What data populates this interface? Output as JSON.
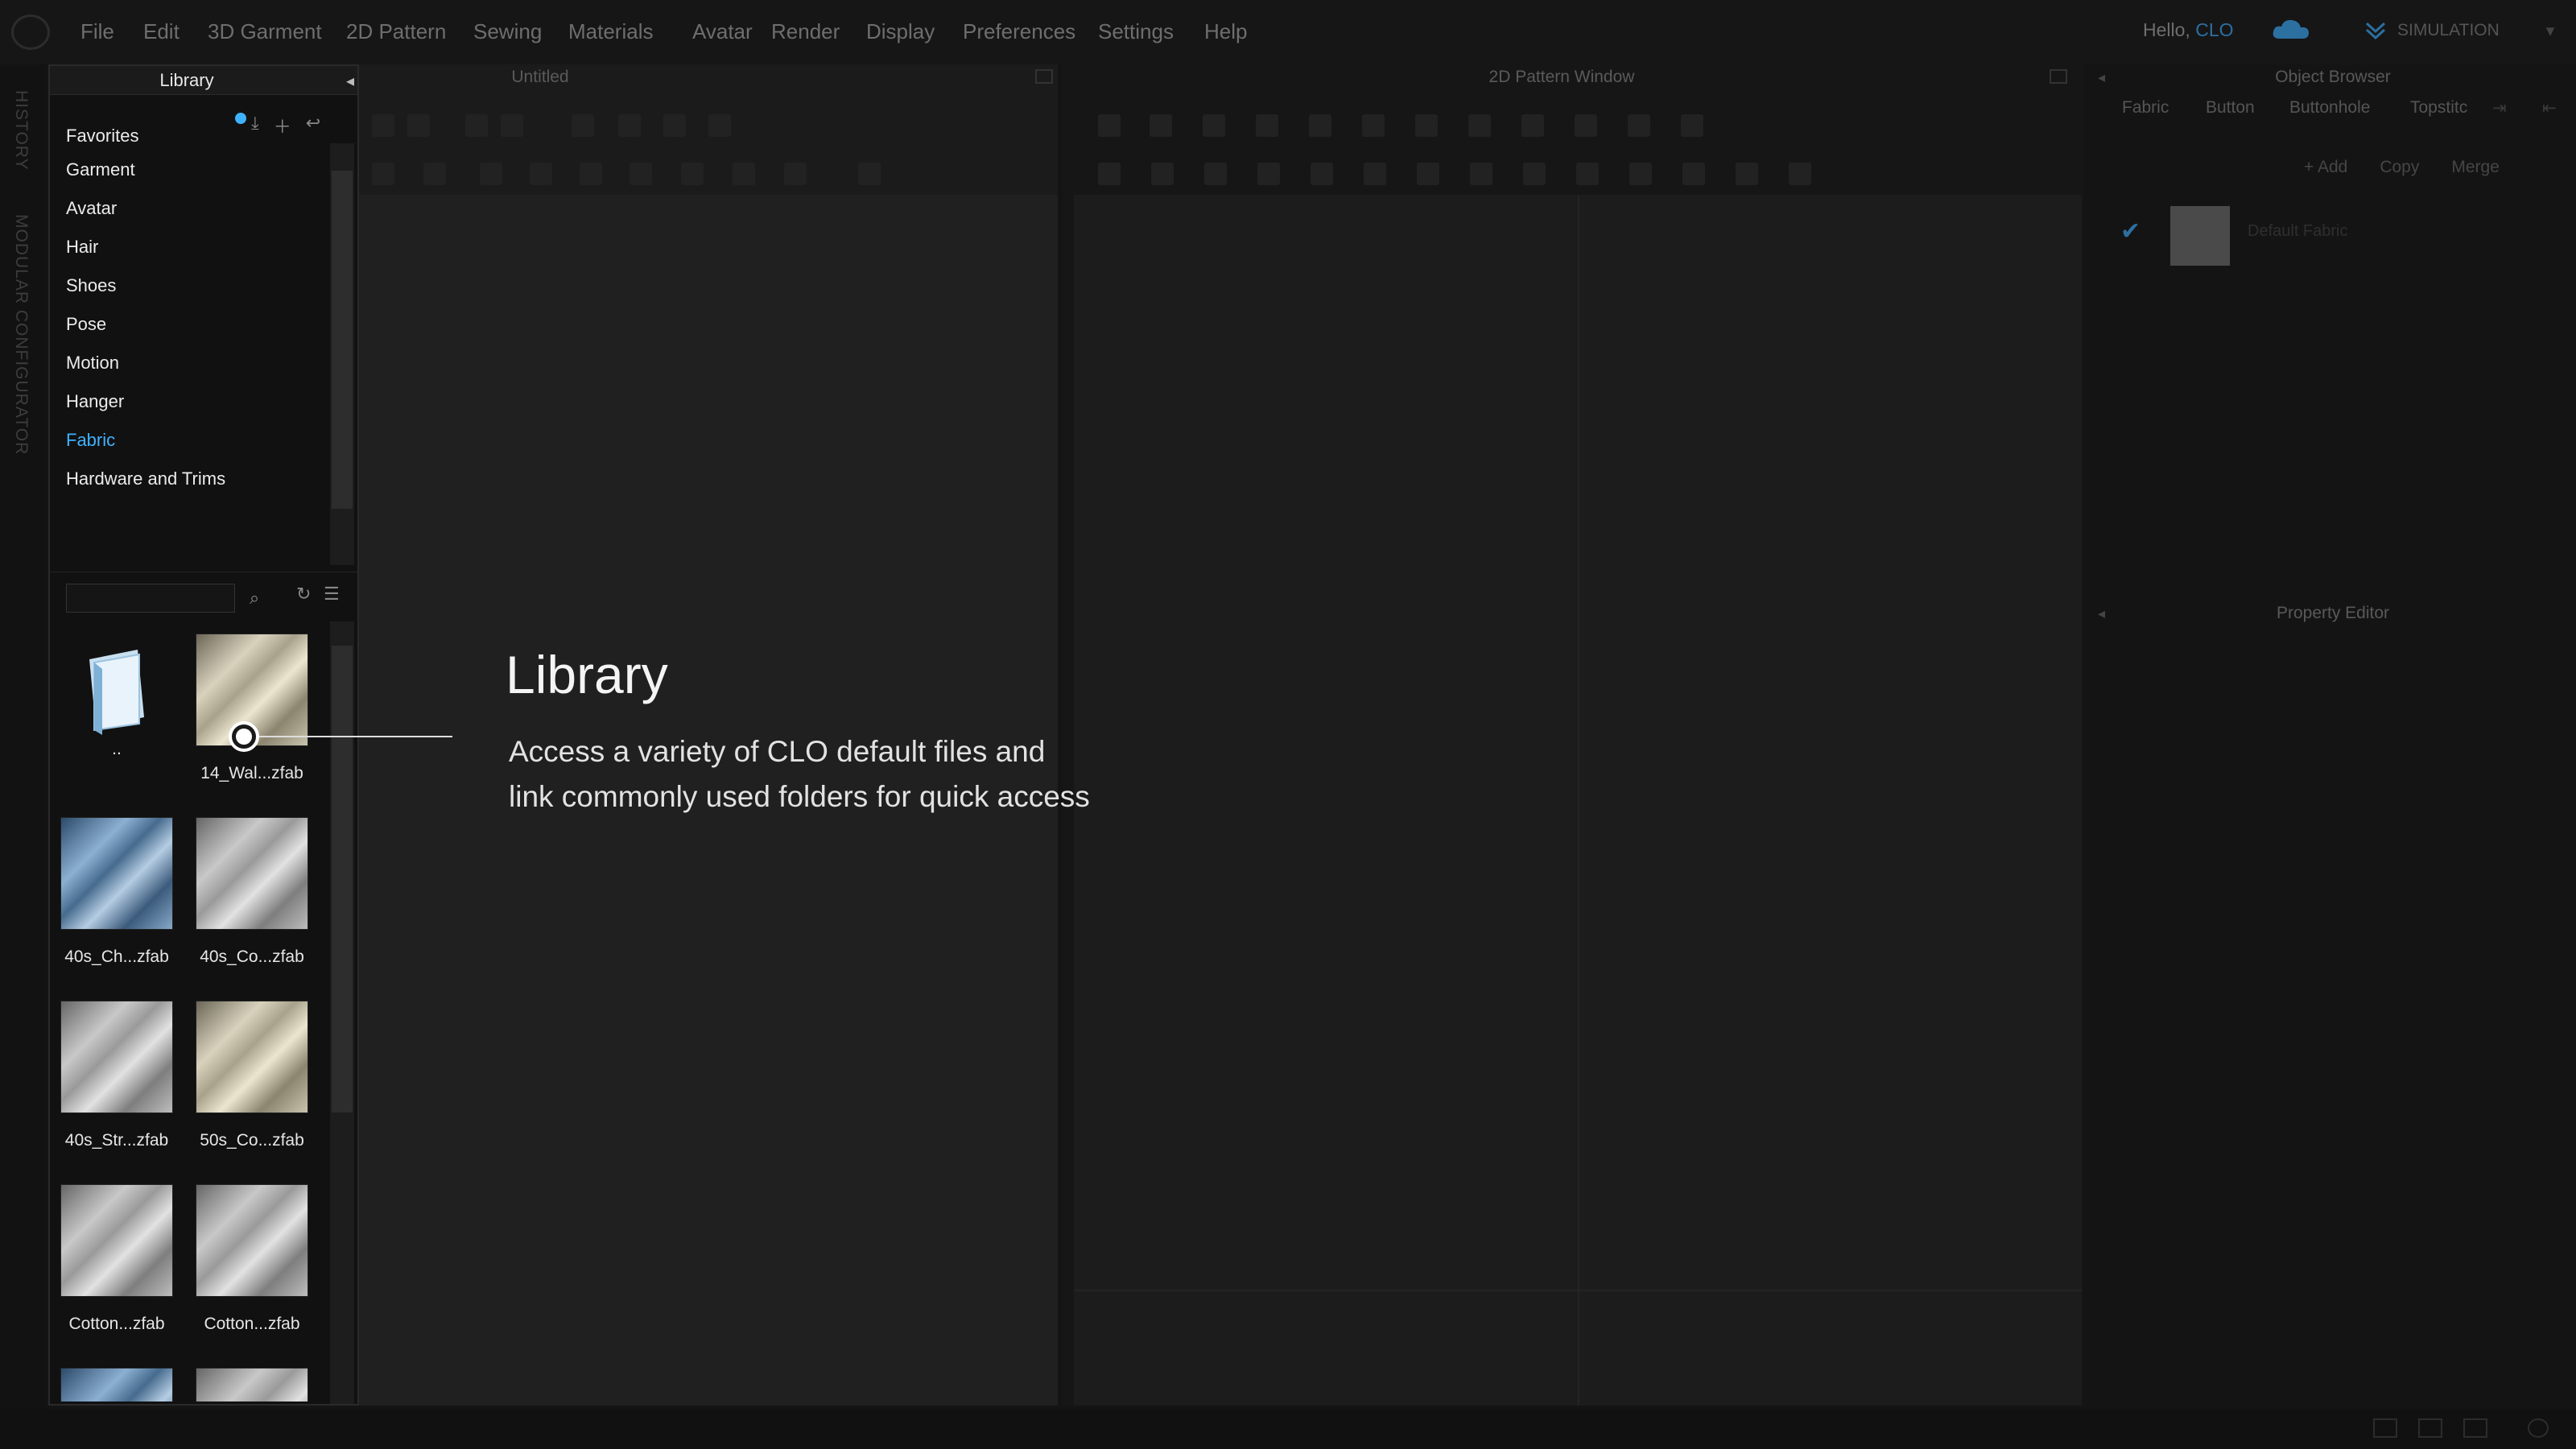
{
  "menubar": {
    "items": [
      "File",
      "Edit",
      "3D Garment",
      "2D Pattern",
      "Sewing",
      "Materials",
      "Avatar",
      "Render",
      "Display",
      "Preferences",
      "Settings",
      "Help"
    ],
    "hello": "Hello, ",
    "user": "CLO",
    "simulation": "SIMULATION"
  },
  "left_tabs": [
    "HISTORY",
    "MODULAR CONFIGURATOR"
  ],
  "library": {
    "title": "Library",
    "categories": [
      "Favorites",
      "Garment",
      "Avatar",
      "Hair",
      "Shoes",
      "Pose",
      "Motion",
      "Hanger",
      "Fabric",
      "Hardware and Trims"
    ],
    "active_category": "Fabric",
    "search_placeholder": "",
    "files": [
      "..",
      "14_Wal...zfab",
      "40s_Ch...zfab",
      "40s_Co...zfab",
      "40s_Str...zfab",
      "50s_Co...zfab",
      "Cotton...zfab",
      "Cotton...zfab",
      "",
      ""
    ]
  },
  "window3d": {
    "title": "Untitled"
  },
  "window2d": {
    "title": "2D Pattern Window"
  },
  "object_browser": {
    "title": "Object Browser",
    "tabs": [
      "Fabric",
      "Button",
      "Buttonhole",
      "Topstitc"
    ],
    "actions": [
      "+ Add",
      "Copy",
      "Merge"
    ],
    "item": "Default Fabric"
  },
  "property_editor": {
    "title": "Property Editor"
  },
  "overlay": {
    "title": "Library",
    "line1": "Access a variety of CLO default files and",
    "line2": "link commonly used folders for quick access"
  },
  "colors": {
    "accent": "#3fb2ff",
    "user": "#2c6fa1"
  }
}
